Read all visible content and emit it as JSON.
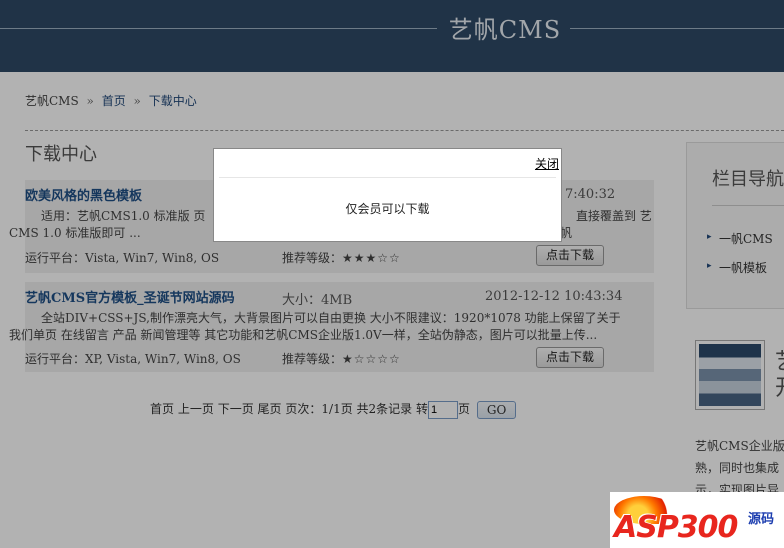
{
  "header": {
    "title": "艺帆CMS"
  },
  "breadcrumb": {
    "home_site": "艺帆CMS",
    "sep1": "»",
    "home": "首页",
    "sep2": "»",
    "current": "下载中心"
  },
  "section_title": "下载中心",
  "items": [
    {
      "name": "欧美风格的黑色模板",
      "date_visible": "7:40:32",
      "desc_line1": "适用：艺帆CMS1.0 标准版 页",
      "desc_line1_right": "直接覆盖到 艺帆",
      "desc_line2": "CMS 1.0 标准版即可 ...",
      "platform_label": "运行平台：",
      "platform": "Vista, Win7, Win8, OS",
      "rating_label": "推荐等级：",
      "stars": "★★★☆☆",
      "download_label": "点击下载"
    },
    {
      "name": "艺帆CMS官方模板_圣诞节网站源码",
      "size_label": "大小：",
      "size": "4MB",
      "date": "2012-12-12 10:43:34",
      "desc_line1": "全站DIV+CSS+JS,制作漂亮大气，大背景图片可以自由更换 大小不限建议：1920*1078 功能上保留了关于",
      "desc_line2": "我们单页 在线留言 产品 新闻管理等 其它功能和艺帆CMS企业版1.0V一样，全站伪静态，图片可以批量上传...",
      "platform_label": "运行平台：",
      "platform": "XP, Vista, Win7, Win8, OS",
      "rating_label": "推荐等级：",
      "stars": "★☆☆☆☆",
      "download_label": "点击下载"
    }
  ],
  "pager": {
    "first": "首页",
    "prev": "上一页",
    "next": "下一页",
    "last": "尾页",
    "pages_label": "页次：",
    "pages": "1/1页",
    "total": "共2条记录",
    "goto_label": "转",
    "goto_value": "1",
    "page_suffix": "页",
    "go": "GO"
  },
  "sidebar": {
    "title": "栏目导航",
    "items": [
      {
        "label": "一帆CMS"
      },
      {
        "label": "一帆模板"
      }
    ],
    "feature_char1": "艺",
    "feature_char2": "开",
    "text_line1": "艺帆CMS企业版",
    "text_line2": "熟，同时也集成",
    "text_line3": "示，实现图片异"
  },
  "dialog": {
    "close": "关闭",
    "message": "仅会员可以下载"
  },
  "watermark": {
    "text": "ASP300",
    "cn": "源码"
  }
}
